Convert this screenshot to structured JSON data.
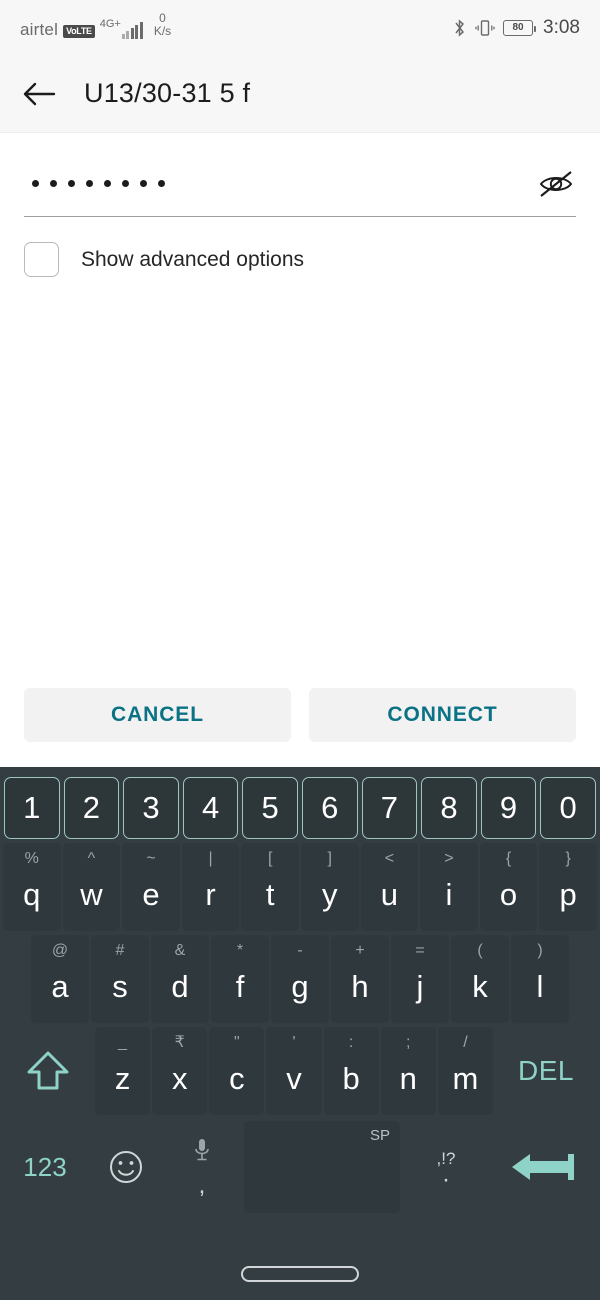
{
  "status_bar": {
    "carrier": "airtel",
    "volte": "VoLTE",
    "network_type": "4G+",
    "data_speed_value": "0",
    "data_speed_unit": "K/s",
    "bluetooth_icon": "bluetooth-icon",
    "vibrate_icon": "vibrate-icon",
    "battery_percent": "80",
    "clock": "3:08"
  },
  "app_bar": {
    "back_icon": "back-arrow-icon",
    "title": "U13/30-31 5 f"
  },
  "form": {
    "password_masked": "••••••••",
    "password_dot_count": 8,
    "toggle_visibility_icon": "eye-off-icon",
    "advanced_checkbox_label": "Show advanced options",
    "advanced_checkbox_checked": false
  },
  "actions": {
    "cancel_label": "CANCEL",
    "connect_label": "CONNECT",
    "accent_color": "#0b7285"
  },
  "keyboard": {
    "accent_color": "#8fd3c8",
    "key_bg": "#2f383c",
    "board_bg": "#343e42",
    "number_row": [
      "1",
      "2",
      "3",
      "4",
      "5",
      "6",
      "7",
      "8",
      "9",
      "0"
    ],
    "row_q": [
      {
        "main": "q",
        "sup": "%"
      },
      {
        "main": "w",
        "sup": "^"
      },
      {
        "main": "e",
        "sup": "~"
      },
      {
        "main": "r",
        "sup": "|"
      },
      {
        "main": "t",
        "sup": "["
      },
      {
        "main": "y",
        "sup": "]"
      },
      {
        "main": "u",
        "sup": "<"
      },
      {
        "main": "i",
        "sup": ">"
      },
      {
        "main": "o",
        "sup": "{"
      },
      {
        "main": "p",
        "sup": "}"
      }
    ],
    "row_a": [
      {
        "main": "a",
        "sup": "@"
      },
      {
        "main": "s",
        "sup": "#"
      },
      {
        "main": "d",
        "sup": "&"
      },
      {
        "main": "f",
        "sup": "*"
      },
      {
        "main": "g",
        "sup": "-"
      },
      {
        "main": "h",
        "sup": "+"
      },
      {
        "main": "j",
        "sup": "="
      },
      {
        "main": "k",
        "sup": "("
      },
      {
        "main": "l",
        "sup": ")"
      }
    ],
    "shift_icon": "shift-up-arrow-icon",
    "row_z": [
      {
        "main": "z",
        "sup": "_"
      },
      {
        "main": "x",
        "sup": "₹"
      },
      {
        "main": "c",
        "sup": "\""
      },
      {
        "main": "v",
        "sup": "'"
      },
      {
        "main": "b",
        "sup": ":"
      },
      {
        "main": "n",
        "sup": ";"
      },
      {
        "main": "m",
        "sup": "/"
      }
    ],
    "delete_label": "DEL",
    "numeric_mode_label": "123",
    "emoji_icon": "smiley-face-icon",
    "mic_icon": "microphone-icon",
    "comma_label": ",",
    "space_label": "SP",
    "punctuation_label": ",!?",
    "period_label": "·",
    "enter_icon": "enter-arrow-icon"
  },
  "nav_bar": {
    "home_pill": "home-gesture-pill"
  }
}
